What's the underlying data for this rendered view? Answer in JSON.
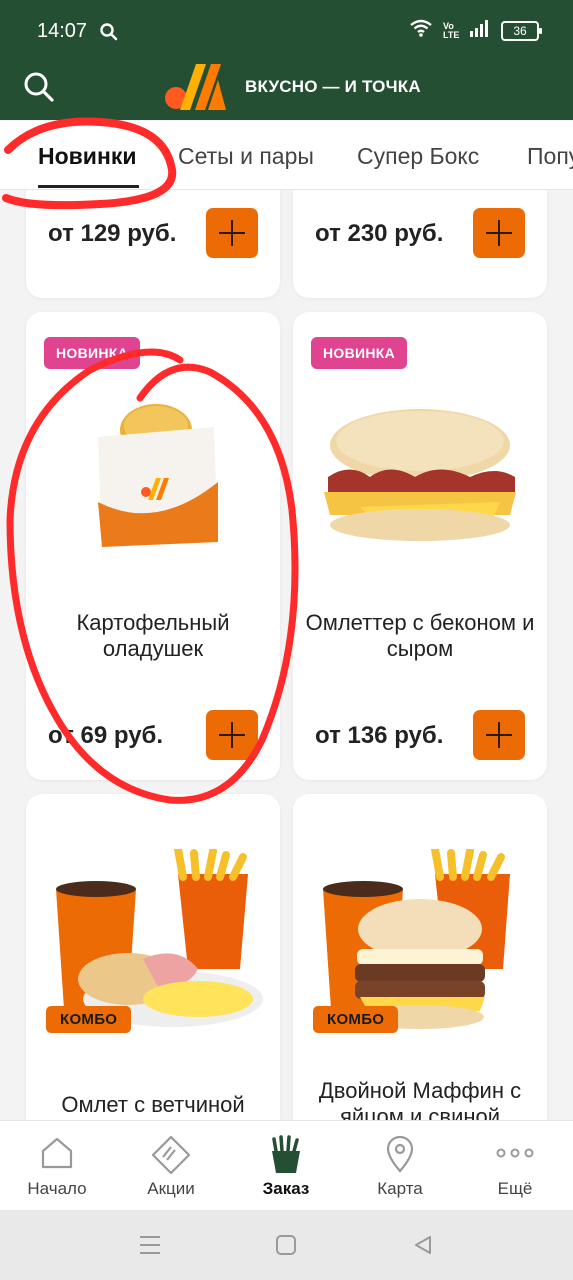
{
  "status_bar": {
    "time": "14:07",
    "network": "Vo LTE",
    "battery": "36"
  },
  "header": {
    "brand": "ВКУСНО — И ТОЧКА"
  },
  "tabs": [
    "Новинки",
    "Сеты и пары",
    "Супер Бокс",
    "Попу"
  ],
  "products": [
    {
      "price": "от 129 руб."
    },
    {
      "price": "от 230 руб."
    },
    {
      "badge": "НОВИНКА",
      "name": "Картофельный оладушек",
      "price": "от 69 руб."
    },
    {
      "badge": "НОВИНКА",
      "name": "Омлеттер с беконом и сыром",
      "price": "от 136 руб."
    },
    {
      "badge": "КОМБО",
      "name": "Омлет с ветчиной"
    },
    {
      "badge": "КОМБО",
      "name": "Двойной Маффин с яйцом и свиной"
    }
  ],
  "bottom_nav": [
    {
      "label": "Начало",
      "icon": "home-icon"
    },
    {
      "label": "Акции",
      "icon": "promo-tag-icon"
    },
    {
      "label": "Заказ",
      "icon": "fries-icon"
    },
    {
      "label": "Карта",
      "icon": "map-pin-icon"
    },
    {
      "label": "Ещё",
      "icon": "more-dots-icon"
    }
  ],
  "colors": {
    "brand_green": "#254f33",
    "accent_orange": "#ec6b04",
    "badge_new": "#e0438f",
    "annotation_red": "#ff2a2a"
  }
}
